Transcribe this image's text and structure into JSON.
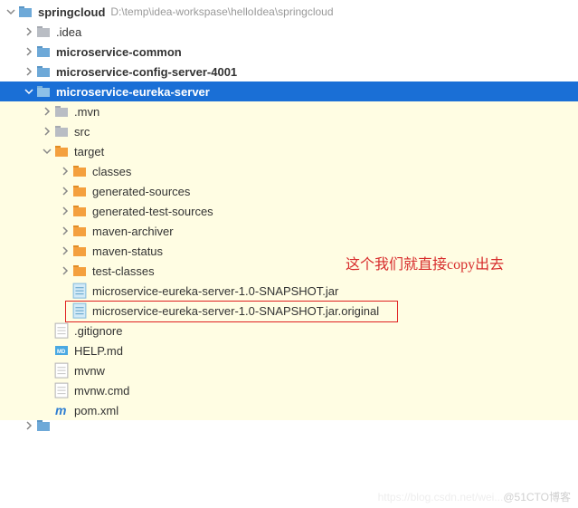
{
  "root": {
    "name": "springcloud",
    "path": "D:\\temp\\idea-workspase\\helloIdea\\springcloud"
  },
  "nodes": {
    "idea": ".idea",
    "common": "microservice-common",
    "config": "microservice-config-server-4001",
    "eureka": "microservice-eureka-server",
    "mvn": ".mvn",
    "src": "src",
    "target": "target",
    "classes": "classes",
    "gensrc": "generated-sources",
    "gentest": "generated-test-sources",
    "archiver": "maven-archiver",
    "status": "maven-status",
    "testclasses": "test-classes",
    "jar": "microservice-eureka-server-1.0-SNAPSHOT.jar",
    "jarorig": "microservice-eureka-server-1.0-SNAPSHOT.jar.original",
    "gitignore": ".gitignore",
    "help": "HELP.md",
    "mvnw": "mvnw",
    "mvnwcmd": "mvnw.cmd",
    "pom": "pom.xml"
  },
  "annotation": "这个我们就直接copy出去",
  "watermark": {
    "faint": "https://blog.csdn.net/wei...",
    "text": "@51CTO博客"
  }
}
